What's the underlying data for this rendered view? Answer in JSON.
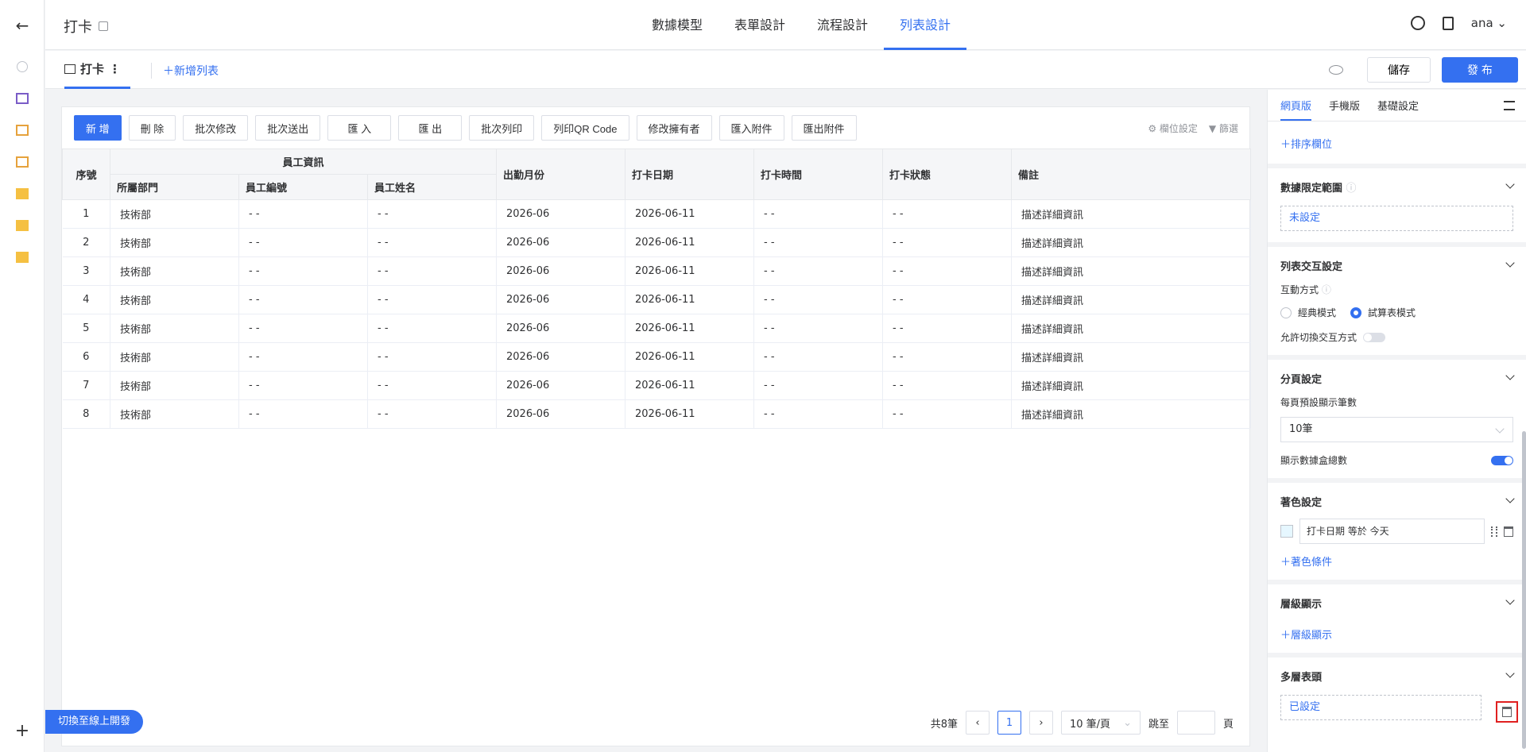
{
  "app": {
    "title": "打卡"
  },
  "nav": {
    "tabs": [
      {
        "label": "數據模型",
        "active": false
      },
      {
        "label": "表單設計",
        "active": false
      },
      {
        "label": "流程設計",
        "active": false
      },
      {
        "label": "列表設計",
        "active": true
      }
    ]
  },
  "user": {
    "name": "ana"
  },
  "subheader": {
    "list_tab": "打卡",
    "add_list": "＋新增列表",
    "save": "儲存",
    "publish": "發 布"
  },
  "toolbar": {
    "buttons": [
      "新 增",
      "刪 除",
      "批次修改",
      "批次送出",
      "匯 入",
      "匯 出",
      "批次列印",
      "列印QR Code",
      "修改擁有者",
      "匯入附件",
      "匯出附件"
    ],
    "field_settings": "欄位設定",
    "filter": "篩選"
  },
  "table": {
    "group_header": "員工資訊",
    "headers": {
      "index": "序號",
      "dept": "所屬部門",
      "emp_no": "員工編號",
      "emp_name": "員工姓名",
      "month": "出勤月份",
      "date": "打卡日期",
      "time": "打卡時間",
      "status": "打卡狀態",
      "note": "備註"
    },
    "rows": [
      [
        "1",
        "技術部",
        "- -",
        "- -",
        "2026-06",
        "2026-06-11",
        "- -",
        "- -",
        "描述詳細資訊"
      ],
      [
        "2",
        "技術部",
        "- -",
        "- -",
        "2026-06",
        "2026-06-11",
        "- -",
        "- -",
        "描述詳細資訊"
      ],
      [
        "3",
        "技術部",
        "- -",
        "- -",
        "2026-06",
        "2026-06-11",
        "- -",
        "- -",
        "描述詳細資訊"
      ],
      [
        "4",
        "技術部",
        "- -",
        "- -",
        "2026-06",
        "2026-06-11",
        "- -",
        "- -",
        "描述詳細資訊"
      ],
      [
        "5",
        "技術部",
        "- -",
        "- -",
        "2026-06",
        "2026-06-11",
        "- -",
        "- -",
        "描述詳細資訊"
      ],
      [
        "6",
        "技術部",
        "- -",
        "- -",
        "2026-06",
        "2026-06-11",
        "- -",
        "- -",
        "描述詳細資訊"
      ],
      [
        "7",
        "技術部",
        "- -",
        "- -",
        "2026-06",
        "2026-06-11",
        "- -",
        "- -",
        "描述詳細資訊"
      ],
      [
        "8",
        "技術部",
        "- -",
        "- -",
        "2026-06",
        "2026-06-11",
        "- -",
        "- -",
        "描述詳細資訊"
      ]
    ]
  },
  "pager": {
    "total": "共8筆",
    "current": "1",
    "page_size": "10 筆/頁",
    "jump_label": "跳至",
    "page_unit": "頁"
  },
  "switch_dev": "切換至線上開發",
  "panel": {
    "tabs": [
      "網頁版",
      "手機版",
      "基礎設定"
    ],
    "sort_field": "＋排序欄位",
    "data_scope": {
      "title": "數據限定範圍",
      "value": "未設定"
    },
    "interaction": {
      "title": "列表交互設定",
      "mode_label": "互動方式",
      "classic": "經典模式",
      "sheet": "試算表模式",
      "allow_switch": "允許切換交互方式"
    },
    "paging": {
      "title": "分頁設定",
      "default_label": "每頁預設顯示筆數",
      "default_value": "10筆",
      "show_total": "顯示數據盒總數"
    },
    "coloring": {
      "title": "著色設定",
      "condition": "打卡日期 等於 今天",
      "add": "＋著色條件"
    },
    "hierarchy": {
      "title": "層級顯示",
      "add": "＋層級顯示"
    },
    "multi_header": {
      "title": "多層表頭",
      "value": "已設定"
    }
  },
  "colors": {
    "accent": "#3470f0",
    "highlight": "#e02020"
  }
}
